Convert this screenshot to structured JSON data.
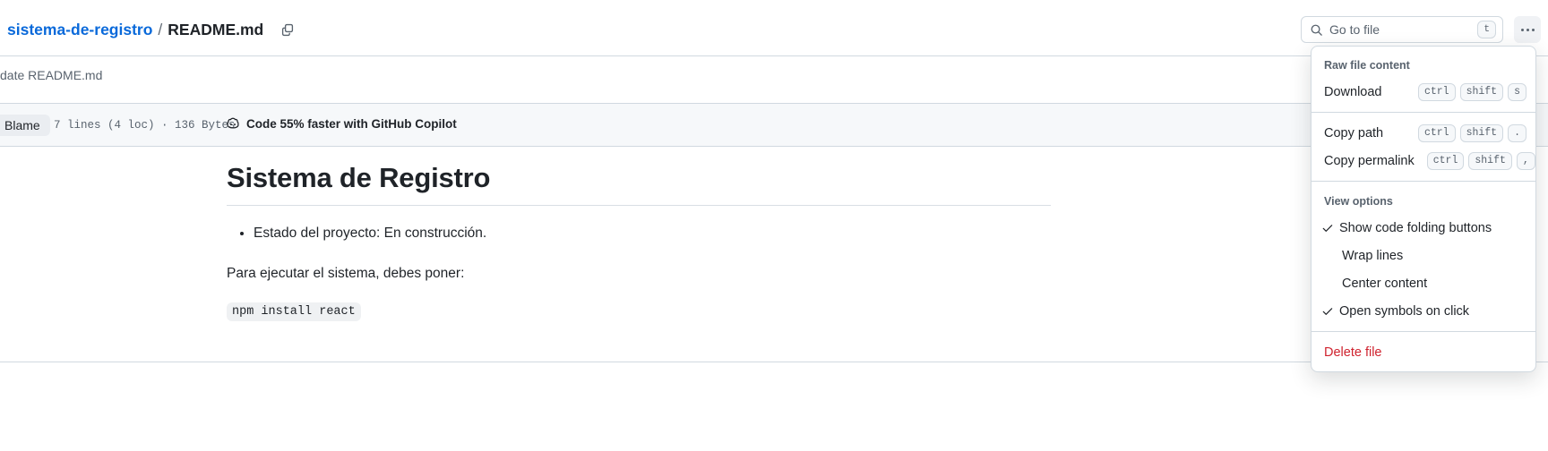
{
  "breadcrumb": {
    "repo": "sistema-de-registro",
    "separator": "/",
    "file": "README.md",
    "copy_icon": "copy-icon"
  },
  "search": {
    "placeholder": "Go to file",
    "icon": "search-icon",
    "shortcut_key": "t"
  },
  "kebab": {
    "icon": "kebab-horizontal-icon"
  },
  "commit": {
    "message": "date README.md"
  },
  "toolbar": {
    "blame_label": "Blame",
    "file_meta": "7 lines (4 loc) · 136 Bytes",
    "copilot_label": "Code 55% faster with GitHub Copilot",
    "copilot_icon": "copilot-icon"
  },
  "content": {
    "heading": "Sistema de Registro",
    "bullets": [
      "Estado del proyecto: En construcción."
    ],
    "paragraph": "Para ejecutar el sistema, debes poner:",
    "code": "npm install react"
  },
  "menu": {
    "group_raw_title": "Raw file content",
    "download": {
      "label": "Download",
      "keys": [
        "ctrl",
        "shift",
        "s"
      ]
    },
    "copy_path": {
      "label": "Copy path",
      "keys": [
        "ctrl",
        "shift",
        "."
      ]
    },
    "copy_permalink": {
      "label": "Copy permalink",
      "keys": [
        "ctrl",
        "shift",
        ","
      ]
    },
    "group_view_title": "View options",
    "show_code_folding": {
      "label": "Show code folding buttons",
      "checked": true
    },
    "wrap_lines": {
      "label": "Wrap lines",
      "checked": false
    },
    "center_content": {
      "label": "Center content",
      "checked": false
    },
    "open_symbols": {
      "label": "Open symbols on click",
      "checked": true
    },
    "delete_file": {
      "label": "Delete file"
    }
  },
  "colors": {
    "link": "#0969da",
    "danger": "#cf222e",
    "border": "#d1d9e0",
    "muted": "#59636e",
    "toolbar_bg": "#f6f8fa"
  }
}
